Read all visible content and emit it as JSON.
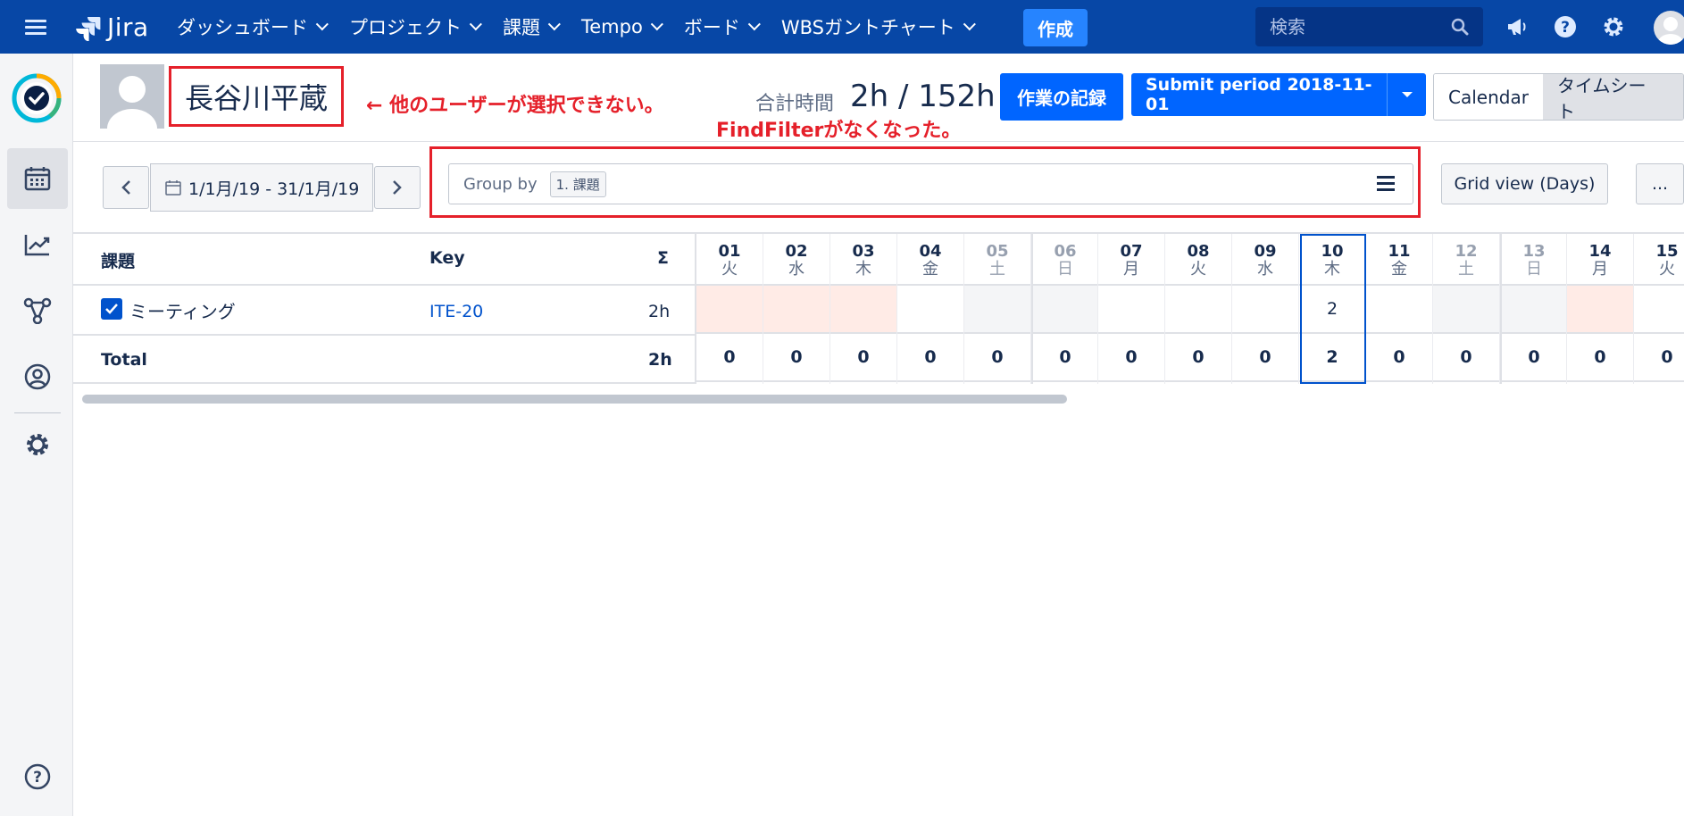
{
  "topnav": {
    "logo_text": "Jira",
    "items": [
      {
        "label": "ダッシュボード"
      },
      {
        "label": "プロジェクト"
      },
      {
        "label": "課題"
      },
      {
        "label": "Tempo"
      },
      {
        "label": "ボード"
      },
      {
        "label": "WBSガントチャート"
      }
    ],
    "create_label": "作成",
    "search_placeholder": "検索"
  },
  "header": {
    "user_name": "長谷川平蔵",
    "annotation_user": "← 他のユーザーが選択できない。",
    "annotation_filter": "FindFilterがなくなった。",
    "total_label": "合計時間",
    "total_value": "2h / 152h",
    "log_work_label": "作業の記録",
    "submit_label": "Submit period 2018-11-01",
    "view_calendar": "Calendar",
    "view_timesheet": "タイムシート"
  },
  "toolbar": {
    "date_range": "1/1月/19 - 31/1月/19",
    "group_by_label": "Group by",
    "group_by_tag": "1. 課題",
    "grid_view_label": "Grid view (Days)",
    "more_label": "..."
  },
  "grid": {
    "col_issue": "課題",
    "col_key": "Key",
    "col_sum": "Σ",
    "days": [
      {
        "num": "01",
        "name": "火",
        "weekend": false,
        "cell": "",
        "bg": "under",
        "total": "0"
      },
      {
        "num": "02",
        "name": "水",
        "weekend": false,
        "cell": "",
        "bg": "under",
        "total": "0"
      },
      {
        "num": "03",
        "name": "木",
        "weekend": false,
        "cell": "",
        "bg": "under",
        "total": "0"
      },
      {
        "num": "04",
        "name": "金",
        "weekend": false,
        "cell": "",
        "bg": "none",
        "total": "0"
      },
      {
        "num": "05",
        "name": "土",
        "weekend": true,
        "cell": "",
        "bg": "weekend",
        "total": "0"
      },
      {
        "num": "06",
        "name": "日",
        "weekend": true,
        "cell": "",
        "bg": "weekend",
        "total": "0"
      },
      {
        "num": "07",
        "name": "月",
        "weekend": false,
        "cell": "",
        "bg": "none",
        "total": "0"
      },
      {
        "num": "08",
        "name": "火",
        "weekend": false,
        "cell": "",
        "bg": "none",
        "total": "0"
      },
      {
        "num": "09",
        "name": "水",
        "weekend": false,
        "cell": "",
        "bg": "none",
        "total": "0"
      },
      {
        "num": "10",
        "name": "木",
        "weekend": false,
        "cell": "2",
        "bg": "none",
        "total": "2"
      },
      {
        "num": "11",
        "name": "金",
        "weekend": false,
        "cell": "",
        "bg": "none",
        "total": "0"
      },
      {
        "num": "12",
        "name": "土",
        "weekend": true,
        "cell": "",
        "bg": "weekend",
        "total": "0"
      },
      {
        "num": "13",
        "name": "日",
        "weekend": true,
        "cell": "",
        "bg": "weekend",
        "total": "0"
      },
      {
        "num": "14",
        "name": "月",
        "weekend": false,
        "cell": "",
        "bg": "under",
        "total": "0"
      },
      {
        "num": "15",
        "name": "火",
        "weekend": false,
        "cell": "",
        "bg": "none",
        "total": "0"
      }
    ],
    "rows": [
      {
        "issue": "ミーティング",
        "key": "ITE-20",
        "sum": "2h"
      }
    ],
    "total_label": "Total",
    "total_sum": "2h"
  },
  "colors": {
    "nav_bg": "#0747a6",
    "primary": "#0065ff",
    "annotation_red": "#e5202a",
    "under_logged": "#ffebe6"
  }
}
